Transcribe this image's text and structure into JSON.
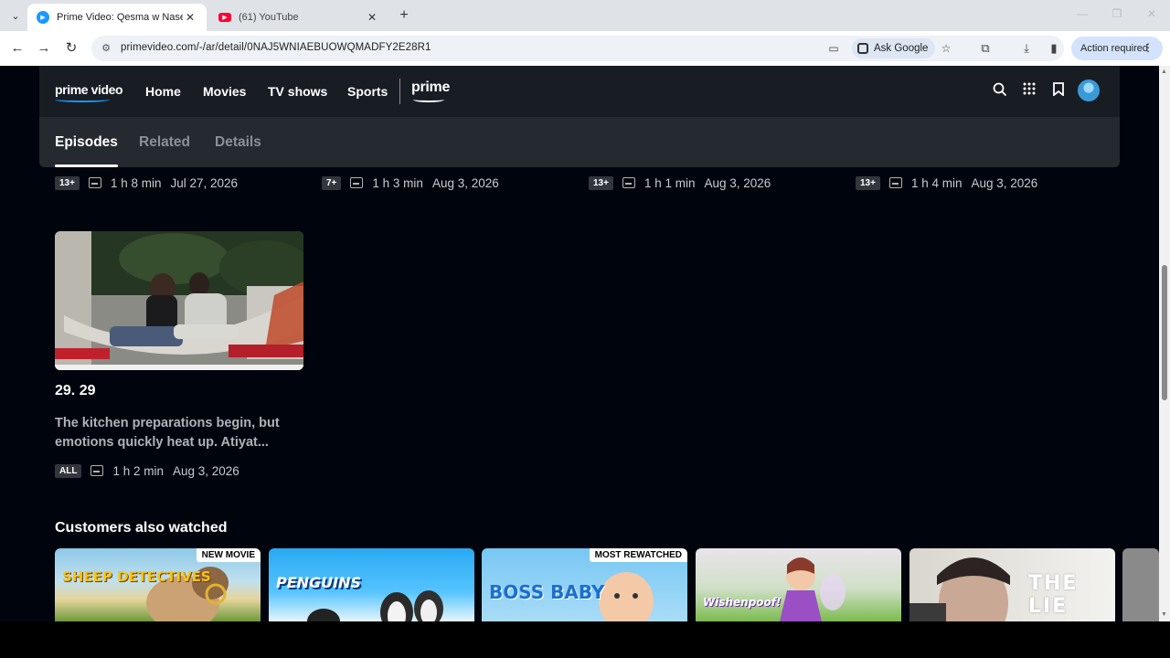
{
  "browser": {
    "tabs": [
      {
        "title": "Prime Video: Qesma w Naseeb",
        "active": true
      },
      {
        "title": "(61) YouTube",
        "active": false
      }
    ],
    "url": "primevideo.com/-/ar/detail/0NAJ5WNIAEBUOWQMADFY2E28R1",
    "ask_google": "Ask Google",
    "action_required": "Action required"
  },
  "header": {
    "logo": "prime video",
    "nav": [
      "Home",
      "Movies",
      "TV shows",
      "Sports"
    ],
    "prime_badge": "prime"
  },
  "subtabs": [
    "Episodes",
    "Related",
    "Details"
  ],
  "episode_meta_rows": [
    {
      "rating": "13+",
      "duration": "1 h 8 min",
      "date": "Jul 27, 2026"
    },
    {
      "rating": "7+",
      "duration": "1 h 3 min",
      "date": "Aug 3, 2026"
    },
    {
      "rating": "13+",
      "duration": "1 h 1 min",
      "date": "Aug 3, 2026"
    },
    {
      "rating": "13+",
      "duration": "1 h 4 min",
      "date": "Aug 3, 2026"
    }
  ],
  "episode": {
    "title": "29. 29",
    "description": "The kitchen preparations begin, but emotions quickly heat up. Atiyat...",
    "rating": "ALL",
    "duration": "1 h 2 min",
    "date": "Aug 3, 2026"
  },
  "also_watched": {
    "title": "Customers also watched",
    "cards": [
      {
        "title": "SHEEP DETECTIVES",
        "badge": "NEW MOVIE"
      },
      {
        "title": "PENGUINS",
        "badge": ""
      },
      {
        "title": "BOSS BABY",
        "badge": "MOST REWATCHED"
      },
      {
        "title": "Wishenpoof!",
        "badge": ""
      },
      {
        "title": "THE LIE",
        "badge": ""
      }
    ]
  }
}
